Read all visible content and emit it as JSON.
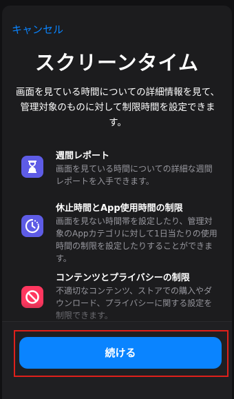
{
  "nav": {
    "cancel_label": "キャンセル"
  },
  "header": {
    "title": "スクリーンタイム",
    "intro": "画面を見ている時間についての詳細情報を見て、管理対象のものに対して制限時間を設定できます。"
  },
  "features": [
    {
      "icon": "hourglass-icon",
      "title": "週間レポート",
      "description": "画面を見ている時間についての詳細な週間レポートを入手できます。"
    },
    {
      "icon": "downtime-clock-icon",
      "title": "休止時間とApp使用時間の制限",
      "description": "画面を見ない時間帯を設定したり、管理対象のAppカテゴリに対して1日当たりの使用時間の制限を設定したりすることができます。"
    },
    {
      "icon": "restriction-icon",
      "title": "コンテンツとプライバシーの制限",
      "description": "不適切なコンテンツ、ストアでの購入やダウンロード、プライバシーに関する設定を制限できます。"
    }
  ],
  "footer": {
    "continue_label": "続ける"
  },
  "colors": {
    "accent": "#0a84ff",
    "icon_purple": "#5e5ce6",
    "icon_red": "#ff375f",
    "highlight_border": "#e0201b"
  }
}
